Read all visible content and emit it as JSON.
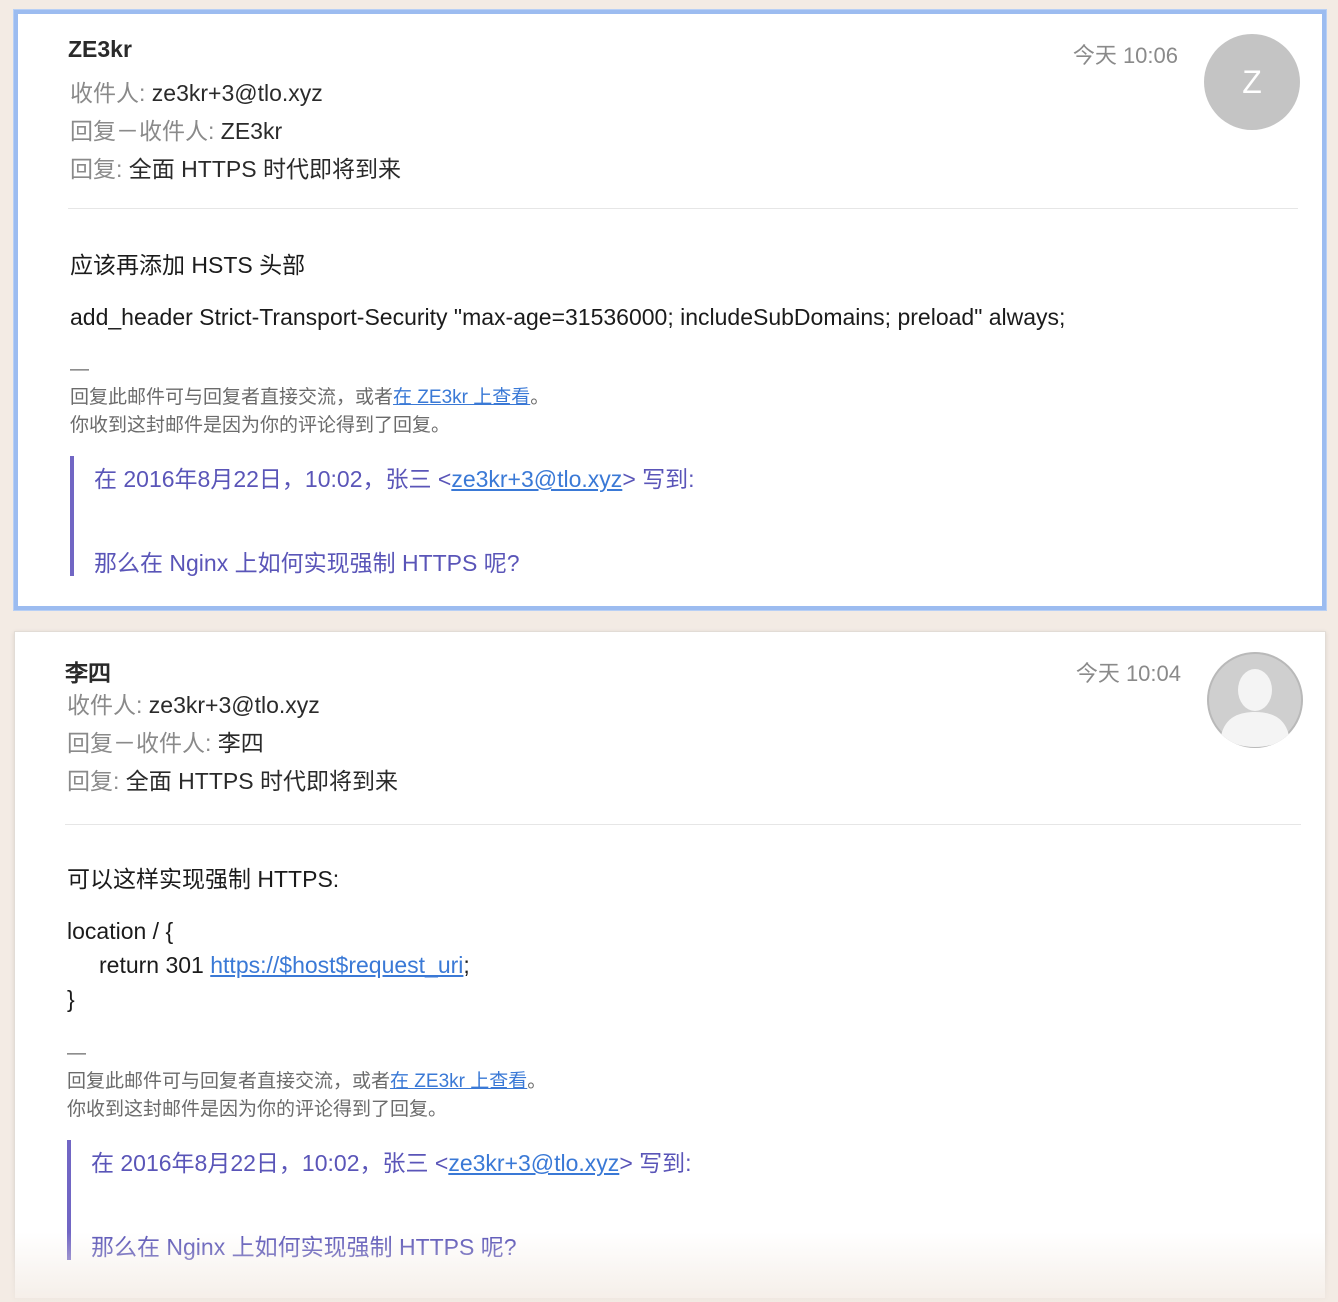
{
  "mails": [
    {
      "sender": "ZE3kr",
      "time": "今天 10:06",
      "avatar_letter": "Z",
      "to_label": "收件人:",
      "to_value": "ze3kr+3@tlo.xyz",
      "reply_to_label": "回复－收件人:",
      "reply_to_value": "ZE3kr",
      "subject_label": "回复:",
      "subject_value": "全面 HTTPS 时代即将到来",
      "body_line1": "应该再添加 HSTS 头部",
      "body_line2": "add_header Strict-Transport-Security \"max-age=31536000; includeSubDomains; preload\" always;",
      "footer_dash": "—",
      "footer_text1": "回复此邮件可与回复者直接交流，或者",
      "footer_link": "在 ZE3kr 上查看",
      "footer_text1_end": "。",
      "footer_text2": "你收到这封邮件是因为你的评论得到了回复。",
      "quote_prefix": "在 2016年8月22日，10:02，张三 <",
      "quote_email": "ze3kr+3@tlo.xyz",
      "quote_suffix": "> 写到:",
      "quote_text": "那么在 Nginx 上如何实现强制 HTTPS 呢?"
    },
    {
      "sender": "李四",
      "time": "今天 10:04",
      "avatar_icon": "person-silhouette-icon",
      "to_label": "收件人:",
      "to_value": "ze3kr+3@tlo.xyz",
      "reply_to_label": "回复－收件人:",
      "reply_to_value": "李四",
      "subject_label": "回复:",
      "subject_value": "全面 HTTPS 时代即将到来",
      "body_line1": "可以这样实现强制 HTTPS:",
      "code_line1": "location / {",
      "code_line2_prefix": "return 301 ",
      "code_line2_link": "https://$host$request_uri",
      "code_line2_suffix": ";",
      "code_line3": "}",
      "footer_dash": "—",
      "footer_text1": "回复此邮件可与回复者直接交流，或者",
      "footer_link": "在 ZE3kr 上查看",
      "footer_text1_end": "。",
      "footer_text2": "你收到这封邮件是因为你的评论得到了回复。",
      "quote_prefix": "在 2016年8月22日，10:02，张三 <",
      "quote_email": "ze3kr+3@tlo.xyz",
      "quote_suffix": "> 写到:",
      "quote_text": "那么在 Nginx 上如何实现强制 HTTPS 呢?"
    }
  ],
  "colors": {
    "selection_border": "#9cbcf0",
    "link": "#3a79d6",
    "quote_bar": "#7166c4",
    "quote_text": "#5a55b8"
  }
}
